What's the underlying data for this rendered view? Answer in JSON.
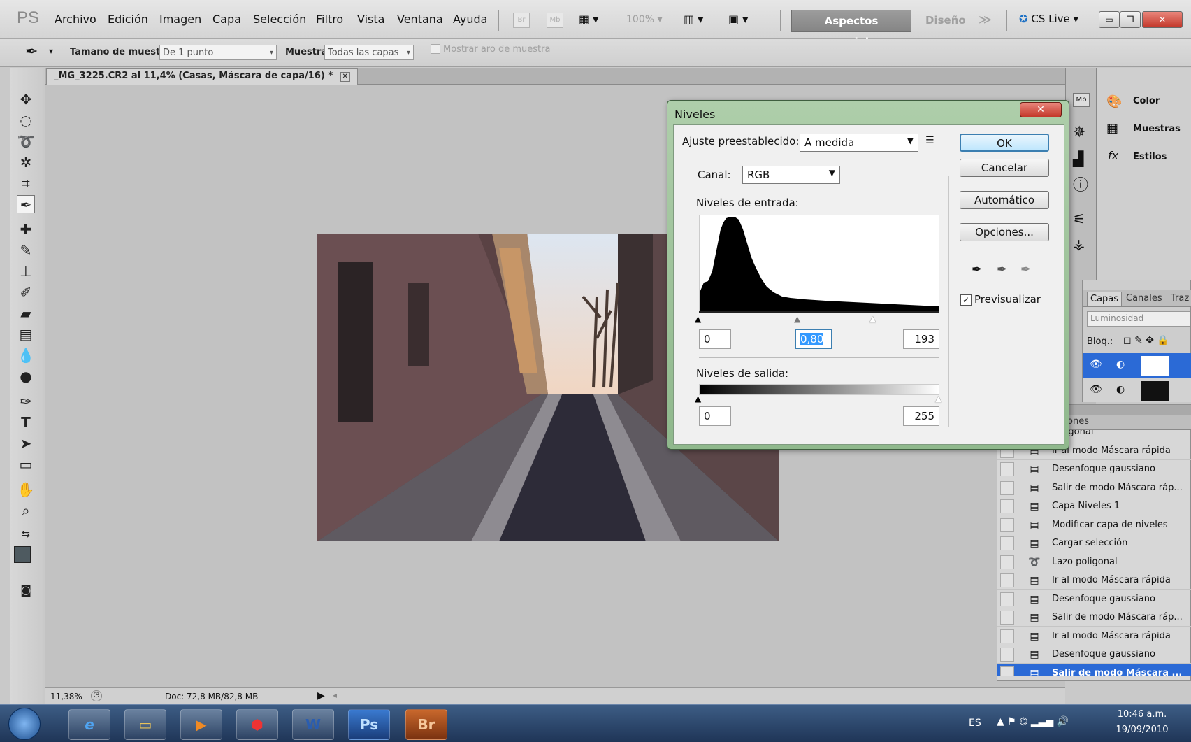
{
  "menubar": {
    "app_logo": "PS",
    "items": [
      "Archivo",
      "Edición",
      "Imagen",
      "Capa",
      "Selección",
      "Filtro",
      "Vista",
      "Ventana",
      "Ayuda"
    ],
    "br_label": "Br",
    "mb_label": "Mb",
    "zoom": "100%",
    "workspace_active": "Aspectos esenciales",
    "workspace_other": "Diseño",
    "more": "≫",
    "cs_live": "CS Live"
  },
  "options": {
    "sample_size_label": "Tamaño de muestra:",
    "sample_size_value": "De 1 punto",
    "sample_label": "Muestra:",
    "sample_value": "Todas las capas",
    "show_ring": "Mostrar aro de muestra"
  },
  "document": {
    "tab_title": "_MG_3225.CR2 al 11,4% (Casas, Máscara de capa/16) *",
    "zoom_status": "11,38%",
    "doc_size": "Doc: 72,8 MB/82,8 MB"
  },
  "dialog": {
    "title": "Niveles",
    "preset_label": "Ajuste preestablecido:",
    "preset_value": "A medida",
    "channel_label": "Canal:",
    "channel_value": "RGB",
    "input_levels_label": "Niveles de entrada:",
    "input_black": "0",
    "input_gamma": "0,80",
    "input_white": "193",
    "output_levels_label": "Niveles de salida:",
    "output_black": "0",
    "output_white": "255",
    "ok": "OK",
    "cancel": "Cancelar",
    "auto": "Automático",
    "options": "Opciones...",
    "preview_label": "Previsualizar",
    "preview_checked": true
  },
  "right_panels": {
    "color": "Color",
    "swatches": "Muestras",
    "styles": "Estilos"
  },
  "layers": {
    "tabs": [
      "Capas",
      "Canales",
      "Traz"
    ],
    "blend_mode": "Luminosidad",
    "lock_label": "Bloq.:"
  },
  "history": {
    "tab_label": "ones",
    "items": [
      {
        "label": "poligonal",
        "icon": "document-icon"
      },
      {
        "label": "Ir al modo Máscara rápida",
        "icon": "document-icon"
      },
      {
        "label": "Desenfoque gaussiano",
        "icon": "document-icon"
      },
      {
        "label": "Salir de modo Máscara ráp...",
        "icon": "document-icon"
      },
      {
        "label": "Capa Niveles 1",
        "icon": "document-icon"
      },
      {
        "label": "Modificar capa de niveles",
        "icon": "document-icon"
      },
      {
        "label": "Cargar selección",
        "icon": "document-icon"
      },
      {
        "label": "Lazo poligonal",
        "icon": "lasso-icon"
      },
      {
        "label": "Ir al modo Máscara rápida",
        "icon": "document-icon"
      },
      {
        "label": "Desenfoque gaussiano",
        "icon": "document-icon"
      },
      {
        "label": "Salir de modo Máscara ráp...",
        "icon": "document-icon"
      },
      {
        "label": "Ir al modo Máscara rápida",
        "icon": "document-icon"
      },
      {
        "label": "Desenfoque gaussiano",
        "icon": "document-icon"
      },
      {
        "label": "Salir de modo Máscara ...",
        "icon": "document-icon",
        "selected": true
      }
    ]
  },
  "taskbar": {
    "apps": [
      "Ps",
      "Br"
    ],
    "lang": "ES",
    "time": "10:46 a.m.",
    "date": "19/09/2010"
  }
}
